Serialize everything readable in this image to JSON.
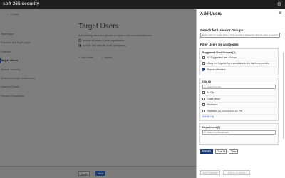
{
  "header": {
    "app_title": "soft 365 security",
    "settings_icon": "gear-icon"
  },
  "breadcrumb": {
    "items": [
      "…",
      "Create"
    ]
  },
  "left_nav": {
    "items": [
      "Technique",
      "Payload and login page",
      "Payload",
      "Target Users",
      "Assign Training",
      "Select end user notification",
      "Launch Details",
      "Review Simulation"
    ],
    "active_index": 3
  },
  "main": {
    "title": "Target Users",
    "description": "Add existing users and groups or import a list of email addresses.",
    "options": [
      {
        "label": "Include all users in your organization",
        "selected": false
      },
      {
        "label": "Include only specific users and groups",
        "selected": true
      }
    ],
    "actions": [
      "Add Users",
      "Import"
    ]
  },
  "footer": {
    "back_label": "Back",
    "next_label": "Next"
  },
  "panel": {
    "title": "Add Users",
    "close_label": "✕",
    "search_title": "Search for Users or Groups",
    "search_placeholder": "Enter User or Group Name. Type at least 3 characters and hit enter to search.",
    "filter_title": "Filter Users by categories",
    "suggested": {
      "title": "Suggested User Groups (1)",
      "items": [
        {
          "label": "All Suggested User Groups",
          "checked": false
        },
        {
          "label": "Users not targeted by a simulation in the last three months",
          "checked": false
        },
        {
          "label": "Repeat offenders",
          "checked": true
        }
      ]
    },
    "city": {
      "title": "City (4)",
      "search_placeholder": "Search by City",
      "items": [
        {
          "label": "All City",
          "checked": false
        },
        {
          "label": "Costa Mesa",
          "checked": false
        },
        {
          "label": "Redmond",
          "checked": false
        },
        {
          "label": "Redmond Xu102933 8:00:57 PM",
          "checked": false
        }
      ],
      "see_all": "See All City"
    },
    "department": {
      "title": "Department (5)",
      "search_placeholder": "Search by Department"
    },
    "apply_label": "Apply(1)",
    "clear_all_label": "Clear All",
    "clear_label": "Clear",
    "add_label": "Add 0 Users(s)",
    "add_all_label": "Add all 28 user(s)"
  },
  "colors": {
    "primary": "#1f3e73",
    "overlay": "#7e7e7e",
    "panel_bg": "#ffffff"
  }
}
